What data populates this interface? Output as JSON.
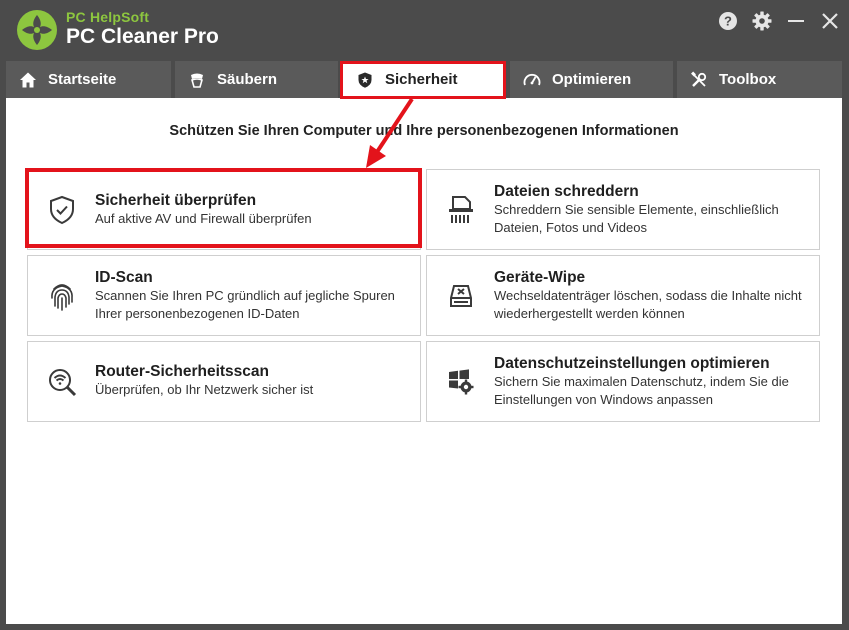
{
  "app": {
    "brand_small": "PC HelpSoft",
    "brand_big": "PC Cleaner Pro",
    "logo_icon": "leaf-logo-icon",
    "accent_color": "#8dc63f",
    "highlight_color": "#e3131b"
  },
  "window_controls": [
    {
      "name": "help-icon"
    },
    {
      "name": "gear-icon"
    },
    {
      "name": "minimize-icon"
    },
    {
      "name": "close-icon"
    }
  ],
  "tabs": [
    {
      "label": "Startseite",
      "icon": "home-icon",
      "active": false
    },
    {
      "label": "Säubern",
      "icon": "broom-icon",
      "active": false
    },
    {
      "label": "Sicherheit",
      "icon": "shield-star-icon",
      "active": true
    },
    {
      "label": "Optimieren",
      "icon": "speedometer-icon",
      "active": false
    },
    {
      "label": "Toolbox",
      "icon": "tools-icon",
      "active": false
    }
  ],
  "main": {
    "headline": "Schützen Sie Ihren Computer und Ihre personenbezogenen Informationen",
    "cards": [
      {
        "title": "Sicherheit überprüfen",
        "desc": "Auf aktive AV und Firewall überprüfen",
        "icon": "shield-check-icon",
        "highlighted": true
      },
      {
        "title": "Dateien schreddern",
        "desc": "Schreddern Sie sensible Elemente, einschließlich Dateien, Fotos und Videos",
        "icon": "shredder-icon"
      },
      {
        "title": "ID-Scan",
        "desc": "Scannen Sie Ihren PC gründlich auf jegliche Spuren Ihrer personenbezogenen ID-Daten",
        "icon": "fingerprint-icon"
      },
      {
        "title": "Geräte-Wipe",
        "desc": "Wechseldatenträger löschen, sodass die Inhalte nicht wiederhergestellt werden können",
        "icon": "drive-wipe-icon"
      },
      {
        "title": "Router-Sicherheitsscan",
        "desc": "Überprüfen, ob Ihr Netzwerk sicher ist",
        "icon": "wifi-search-icon"
      },
      {
        "title": "Datenschutzeinstellungen optimieren",
        "desc": "Sichern Sie maximalen Datenschutz, indem Sie die Einstellungen von Windows anpassen",
        "icon": "windows-gear-icon"
      }
    ]
  }
}
